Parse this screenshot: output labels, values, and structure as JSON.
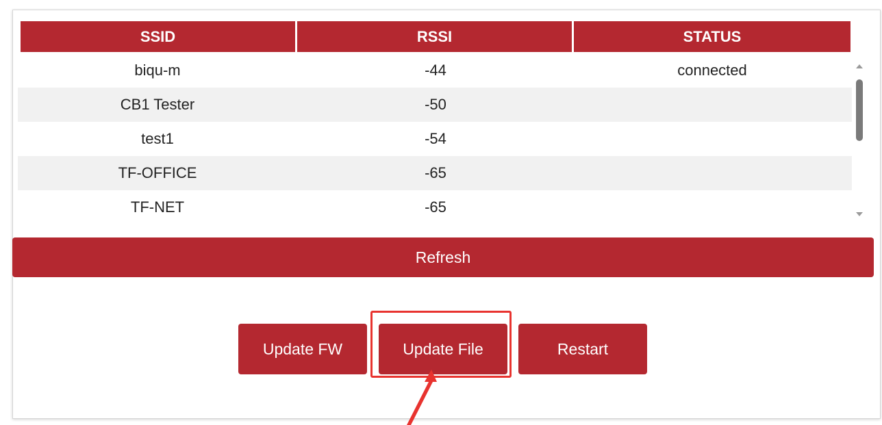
{
  "table": {
    "columns": [
      "SSID",
      "RSSI",
      "STATUS"
    ],
    "rows": [
      {
        "ssid": "biqu-m",
        "rssi": "-44",
        "status": "connected"
      },
      {
        "ssid": "CB1 Tester",
        "rssi": "-50",
        "status": ""
      },
      {
        "ssid": "test1",
        "rssi": "-54",
        "status": ""
      },
      {
        "ssid": "TF-OFFICE",
        "rssi": "-65",
        "status": ""
      },
      {
        "ssid": "TF-NET",
        "rssi": "-65",
        "status": ""
      }
    ]
  },
  "buttons": {
    "refresh": "Refresh",
    "update_fw": "Update FW",
    "update_file": "Update File",
    "restart": "Restart"
  },
  "colors": {
    "accent": "#b42830",
    "highlight": "#e8332f"
  },
  "icons": {
    "scroll_up": "chevron-up-icon",
    "scroll_down": "chevron-down-icon",
    "annotation": "arrow-icon"
  }
}
